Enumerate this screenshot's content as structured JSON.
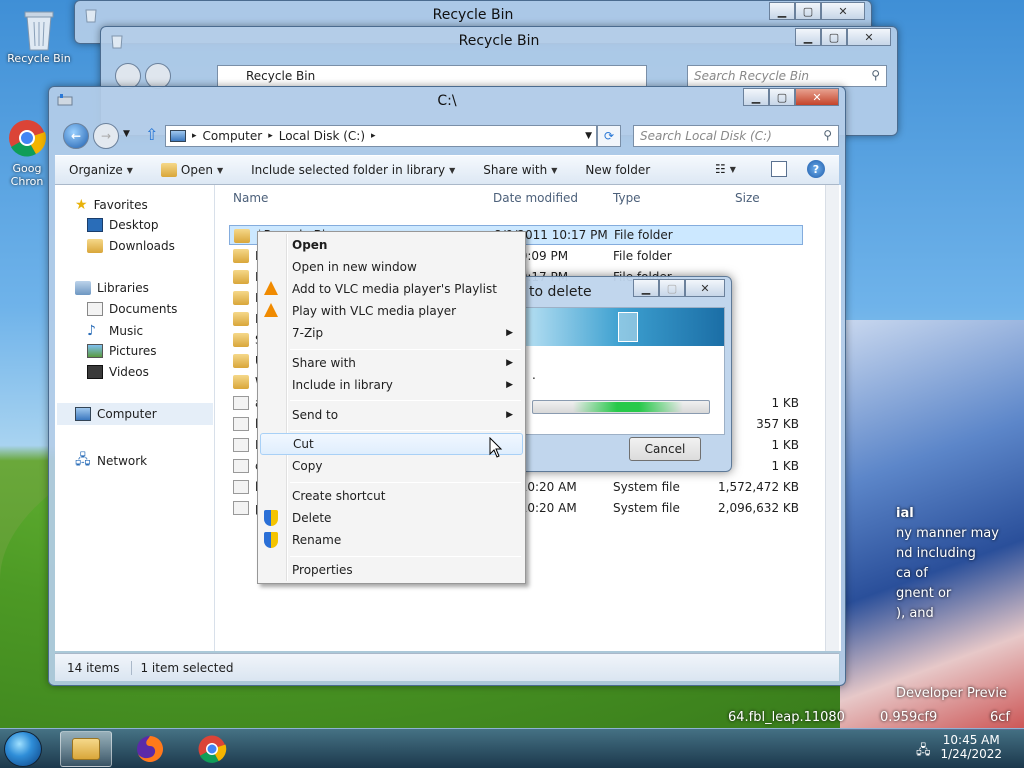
{
  "desktop": {
    "recycle_bin_label": "Recycle Bin",
    "chrome_label_1": "Goog",
    "chrome_label_2": "Chron",
    "overlay_1": "ial",
    "overlay_2": "ny manner may",
    "overlay_3": "nd including",
    "overlay_4": "ca  of",
    "overlay_5": "gnent or",
    "overlay_6": "), and",
    "watermark_1": "Developer Previe",
    "watermark_2": "64.fbl_leap.11080",
    "watermark_3": "0.959cf9",
    "watermark_4": "6cf"
  },
  "back_window_1": {
    "title": "Recycle Bin"
  },
  "back_window_2": {
    "title": "Recycle Bin",
    "address": "Recycle Bin",
    "search_placeholder": "Search Recycle Bin"
  },
  "explorer": {
    "title": "C:\\",
    "address": {
      "crumb_1": "Computer",
      "crumb_2": "Local Disk (C:)"
    },
    "search_placeholder": "Search Local Disk (C:)",
    "toolbar": {
      "organize": "Organize",
      "open": "Open",
      "include": "Include selected folder in library",
      "share": "Share with",
      "new_folder": "New folder"
    },
    "nav": {
      "favorites": "Favorites",
      "desktop": "Desktop",
      "downloads": "Downloads",
      "libraries": "Libraries",
      "documents": "Documents",
      "music": "Music",
      "pictures": "Pictures",
      "videos": "Videos",
      "computer": "Computer",
      "network": "Network"
    },
    "columns": {
      "name": "Name",
      "date": "Date modified",
      "type": "Type",
      "size": "Size"
    },
    "rows": [
      {
        "name": "$Recycle.Bin",
        "date": "8/9/2011 10:17 PM",
        "type": "File folder",
        "size": ""
      },
      {
        "name": "D",
        "date": "11 10:09 PM",
        "type": "File folder",
        "size": ""
      },
      {
        "name": "P",
        "date": "11 10:17 PM",
        "type": "File folder",
        "size": ""
      },
      {
        "name": "P",
        "date": "",
        "type": "",
        "size": ""
      },
      {
        "name": "P",
        "date": "",
        "type": "",
        "size": ""
      },
      {
        "name": "S",
        "date": "",
        "type": "",
        "size": ""
      },
      {
        "name": "U",
        "date": "",
        "type": "",
        "size": ""
      },
      {
        "name": "W",
        "date": "",
        "type": "",
        "size": ""
      },
      {
        "name": "a",
        "date": "",
        "type": "",
        "size": "1 KB"
      },
      {
        "name": "b",
        "date": "",
        "type": "",
        "size": "357 KB"
      },
      {
        "name": "B",
        "date": "",
        "type": "",
        "size": "1 KB"
      },
      {
        "name": "c",
        "date": "",
        "type": "",
        "size": "1 KB"
      },
      {
        "name": "h",
        "date": "022 10:20 AM",
        "type": "System file",
        "size": "1,572,472 KB"
      },
      {
        "name": "p",
        "date": "022 10:20 AM",
        "type": "System file",
        "size": "2,096,632 KB"
      }
    ],
    "status": {
      "items": "14 items",
      "selected": "1 item selected"
    }
  },
  "dialog": {
    "title": "to delete",
    "partial_text": ".",
    "cancel": "Cancel"
  },
  "context_menu": {
    "open": "Open",
    "open_new_window": "Open in new window",
    "vlc_playlist": "Add to VLC media player's Playlist",
    "vlc_play": "Play with VLC media player",
    "seven_zip": "7-Zip",
    "share_with": "Share with",
    "include_library": "Include in library",
    "send_to": "Send to",
    "cut": "Cut",
    "copy": "Copy",
    "create_shortcut": "Create shortcut",
    "delete": "Delete",
    "rename": "Rename",
    "properties": "Properties"
  },
  "taskbar": {
    "time": "10:45 AM",
    "date": "1/24/2022"
  },
  "icons": {
    "recycle_bin": "recycle-bin-icon",
    "chrome": "chrome-icon",
    "firefox": "firefox-icon",
    "explorer": "explorer-icon",
    "vlc": "vlc-icon",
    "shield": "uac-shield-icon"
  }
}
